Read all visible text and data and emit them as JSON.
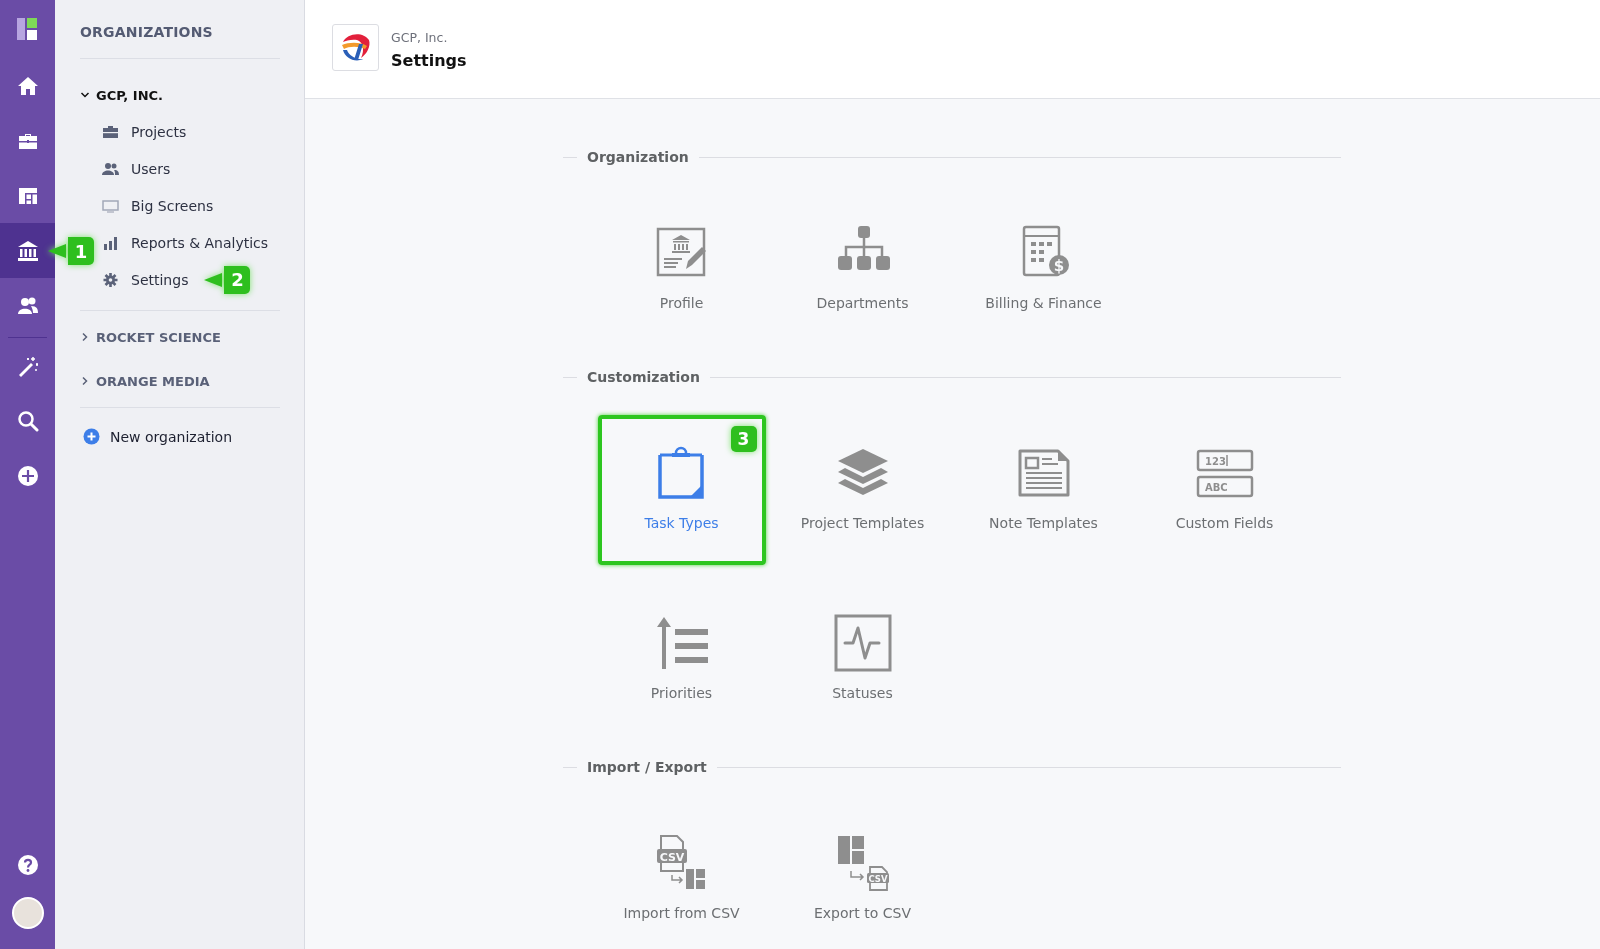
{
  "rail": {
    "items": [
      {
        "kind": "logo"
      },
      {
        "kind": "home",
        "selected": false
      },
      {
        "kind": "briefcase",
        "selected": false
      },
      {
        "kind": "dashboard",
        "selected": false
      },
      {
        "kind": "bank",
        "selected": true,
        "callout": {
          "label": "1",
          "kind": "pointer"
        }
      },
      {
        "kind": "users",
        "selected": false
      },
      {
        "kind": "divider"
      },
      {
        "kind": "wand",
        "selected": false
      },
      {
        "kind": "search",
        "selected": false
      },
      {
        "kind": "add",
        "selected": false
      }
    ],
    "bottom": [
      {
        "kind": "help"
      },
      {
        "kind": "avatar"
      }
    ]
  },
  "sidebar": {
    "heading": "ORGANIZATIONS",
    "organizations": [
      {
        "name": "GCP, INC.",
        "expanded": true,
        "children": [
          {
            "label": "Projects",
            "kind": "briefcase"
          },
          {
            "label": "Users",
            "kind": "users"
          },
          {
            "label": "Big Screens",
            "kind": "screen"
          },
          {
            "label": "Reports & Analytics",
            "kind": "bars"
          },
          {
            "label": "Settings",
            "kind": "gear",
            "callout": {
              "label": "2",
              "kind": "pointer"
            }
          }
        ]
      },
      {
        "name": "ROCKET SCIENCE",
        "expanded": false
      },
      {
        "name": "ORANGE MEDIA",
        "expanded": false
      }
    ],
    "new_button": "New organization"
  },
  "header": {
    "subtitle": "GCP, Inc.",
    "title": "Settings"
  },
  "sections": [
    {
      "title": "Organization",
      "tiles": [
        {
          "label": "Profile",
          "kind": "profile",
          "selected": false
        },
        {
          "label": "Departments",
          "kind": "departments",
          "selected": false
        },
        {
          "label": "Billing & Finance",
          "kind": "billing",
          "selected": false,
          "icon_texts": [
            "$"
          ]
        }
      ]
    },
    {
      "title": "Customization",
      "tiles": [
        {
          "label": "Task Types",
          "kind": "task-types",
          "selected": true,
          "callout": {
            "label": "3",
            "kind": "tag"
          }
        },
        {
          "label": "Project Templates",
          "kind": "layers",
          "selected": false
        },
        {
          "label": "Note Templates",
          "kind": "note",
          "selected": false
        },
        {
          "label": "Custom Fields",
          "kind": "fields",
          "selected": false,
          "icon_texts": [
            "123",
            "ABC"
          ]
        },
        {
          "label": "Priorities",
          "kind": "priorities",
          "selected": false
        },
        {
          "label": "Statuses",
          "kind": "statuses",
          "selected": false
        }
      ]
    },
    {
      "title": "Import / Export",
      "tiles": [
        {
          "label": "Import from CSV",
          "kind": "import",
          "selected": false,
          "icon_texts": [
            "CSV"
          ]
        },
        {
          "label": "Export to CSV",
          "kind": "export",
          "selected": false,
          "icon_texts": [
            "CSV"
          ]
        }
      ]
    }
  ]
}
